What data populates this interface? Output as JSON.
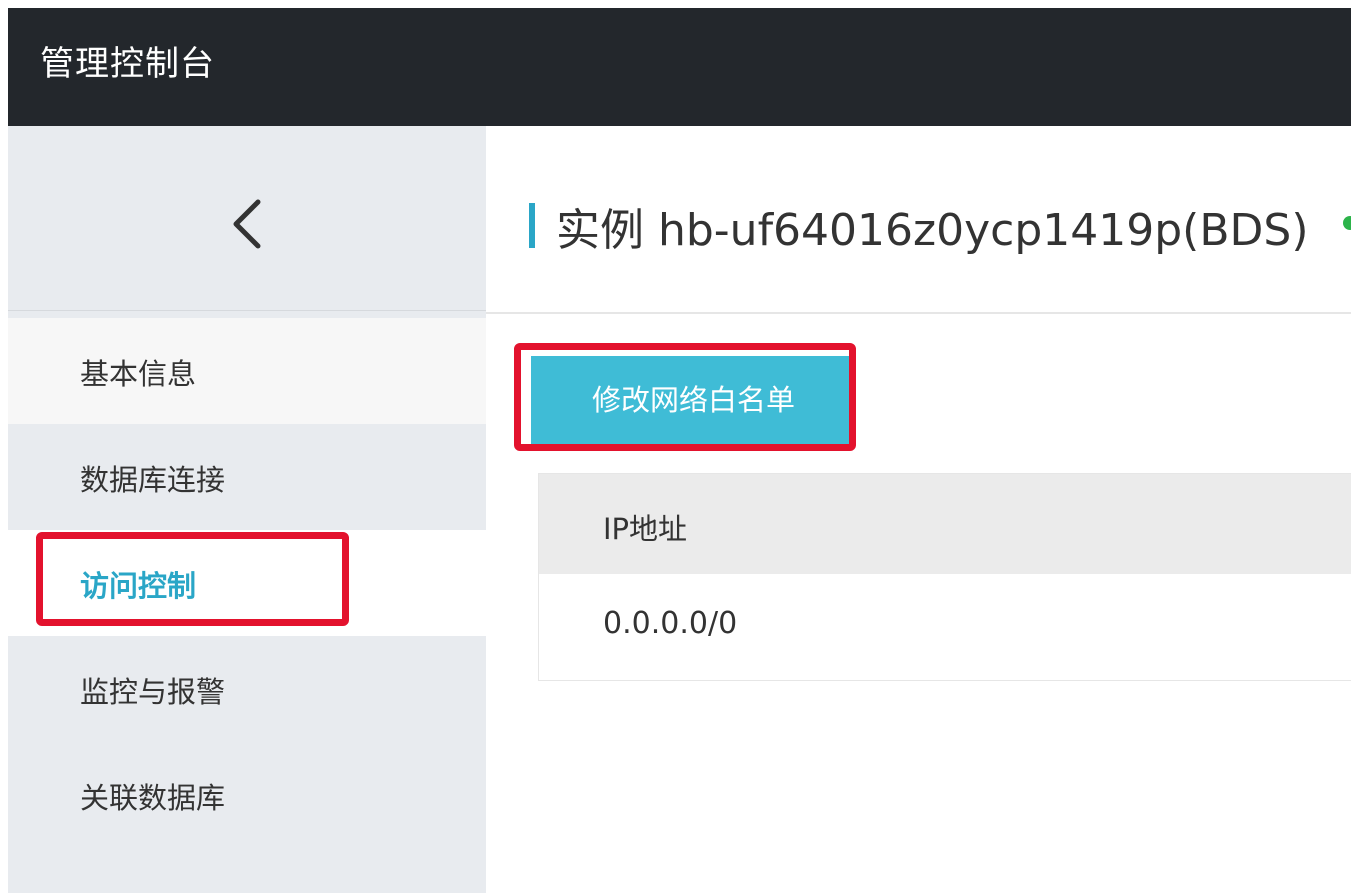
{
  "header": {
    "title": "管理控制台"
  },
  "sidebar": {
    "back_icon": "chevron-left-icon",
    "items": [
      {
        "label": "基本信息"
      },
      {
        "label": "数据库连接"
      },
      {
        "label": "访问控制"
      },
      {
        "label": "监控与报警"
      },
      {
        "label": "关联数据库"
      }
    ],
    "active_item": "访问控制"
  },
  "main": {
    "instance_title": "实例 hb-uf64016z0ycp1419p(BDS)",
    "whitelist_button_label": "修改网络白名单",
    "table": {
      "column_header": "IP地址",
      "rows": [
        {
          "ip": "0.0.0.0/0"
        }
      ]
    }
  },
  "colors": {
    "accent": "#2aa6c7",
    "button": "#3fbcd6",
    "highlight_box": "#e3122d",
    "topbar": "#23272c",
    "status": "#2cb34a"
  }
}
